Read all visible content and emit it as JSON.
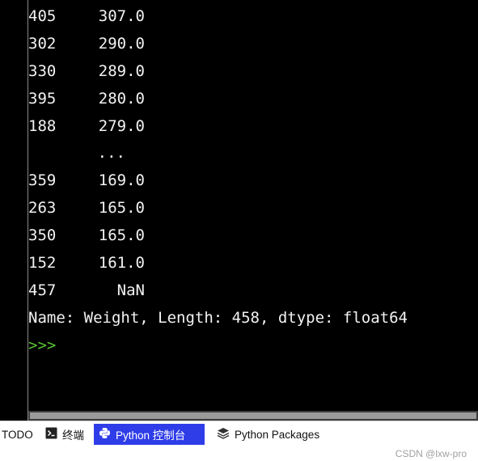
{
  "console": {
    "rows": [
      {
        "index": "405",
        "value": "307.0"
      },
      {
        "index": "302",
        "value": "290.0"
      },
      {
        "index": "330",
        "value": "289.0"
      },
      {
        "index": "395",
        "value": "280.0"
      },
      {
        "index": "188",
        "value": "279.0"
      }
    ],
    "ellipsis": "...",
    "rows_tail": [
      {
        "index": "359",
        "value": "169.0"
      },
      {
        "index": "263",
        "value": "165.0"
      },
      {
        "index": "350",
        "value": "165.0"
      },
      {
        "index": "152",
        "value": "161.0"
      },
      {
        "index": "457",
        "value": "NaN"
      }
    ],
    "summary": "Name: Weight, Length: 458, dtype: float64",
    "prompt": ">>>"
  },
  "tabs": [
    {
      "label": "TODO",
      "icon": "none"
    },
    {
      "label": "终端",
      "icon": "terminal-icon"
    },
    {
      "label": "Python 控制台",
      "icon": "python-icon",
      "active": true
    },
    {
      "label": "Python Packages",
      "icon": "packages-icon"
    }
  ],
  "watermark": "CSDN @lxw-pro",
  "colors": {
    "prompt": "#5bc236",
    "active_tab": "#2f3de8"
  }
}
